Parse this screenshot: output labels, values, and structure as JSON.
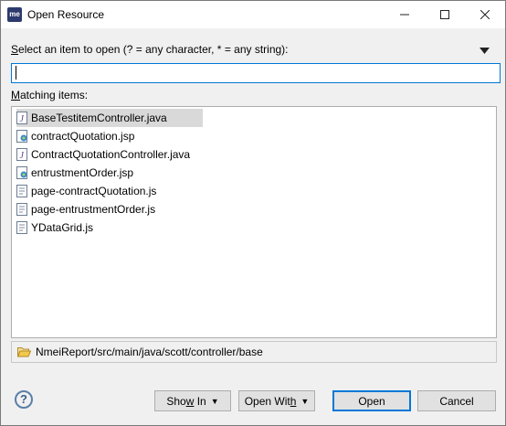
{
  "window": {
    "title": "Open Resource",
    "app_icon_text": "me"
  },
  "prompt": {
    "prefix": "",
    "accel": "S",
    "rest": "elect an item to open (? = any character, * = any string):"
  },
  "filter": {
    "value": "",
    "placeholder": ""
  },
  "matching": {
    "accel": "M",
    "rest": "atching items:"
  },
  "items": [
    {
      "label": "BaseTestitemController.java",
      "icon": "java-file-icon",
      "selected": true
    },
    {
      "label": "contractQuotation.jsp",
      "icon": "jsp-file-icon",
      "selected": false
    },
    {
      "label": "ContractQuotationController.java",
      "icon": "java-file-icon",
      "selected": false
    },
    {
      "label": "entrustmentOrder.jsp",
      "icon": "jsp-file-icon",
      "selected": false
    },
    {
      "label": "page-contractQuotation.js",
      "icon": "js-file-icon",
      "selected": false
    },
    {
      "label": "page-entrustmentOrder.js",
      "icon": "js-file-icon",
      "selected": false
    },
    {
      "label": "YDataGrid.js",
      "icon": "js-file-icon",
      "selected": false
    }
  ],
  "path": "NmeiReport/src/main/java/scott/controller/base",
  "buttons": {
    "help": "?",
    "show_in_pre": "Sho",
    "show_in_accel": "w",
    "show_in_post": " In",
    "open_with_pre": "Open Wit",
    "open_with_accel": "h",
    "open_with_post": "",
    "open": "Open",
    "cancel": "Cancel"
  },
  "colors": {
    "accent": "#0078d7",
    "selection": "#d9d9d9",
    "dialog_bg": "#f0f0f0"
  }
}
